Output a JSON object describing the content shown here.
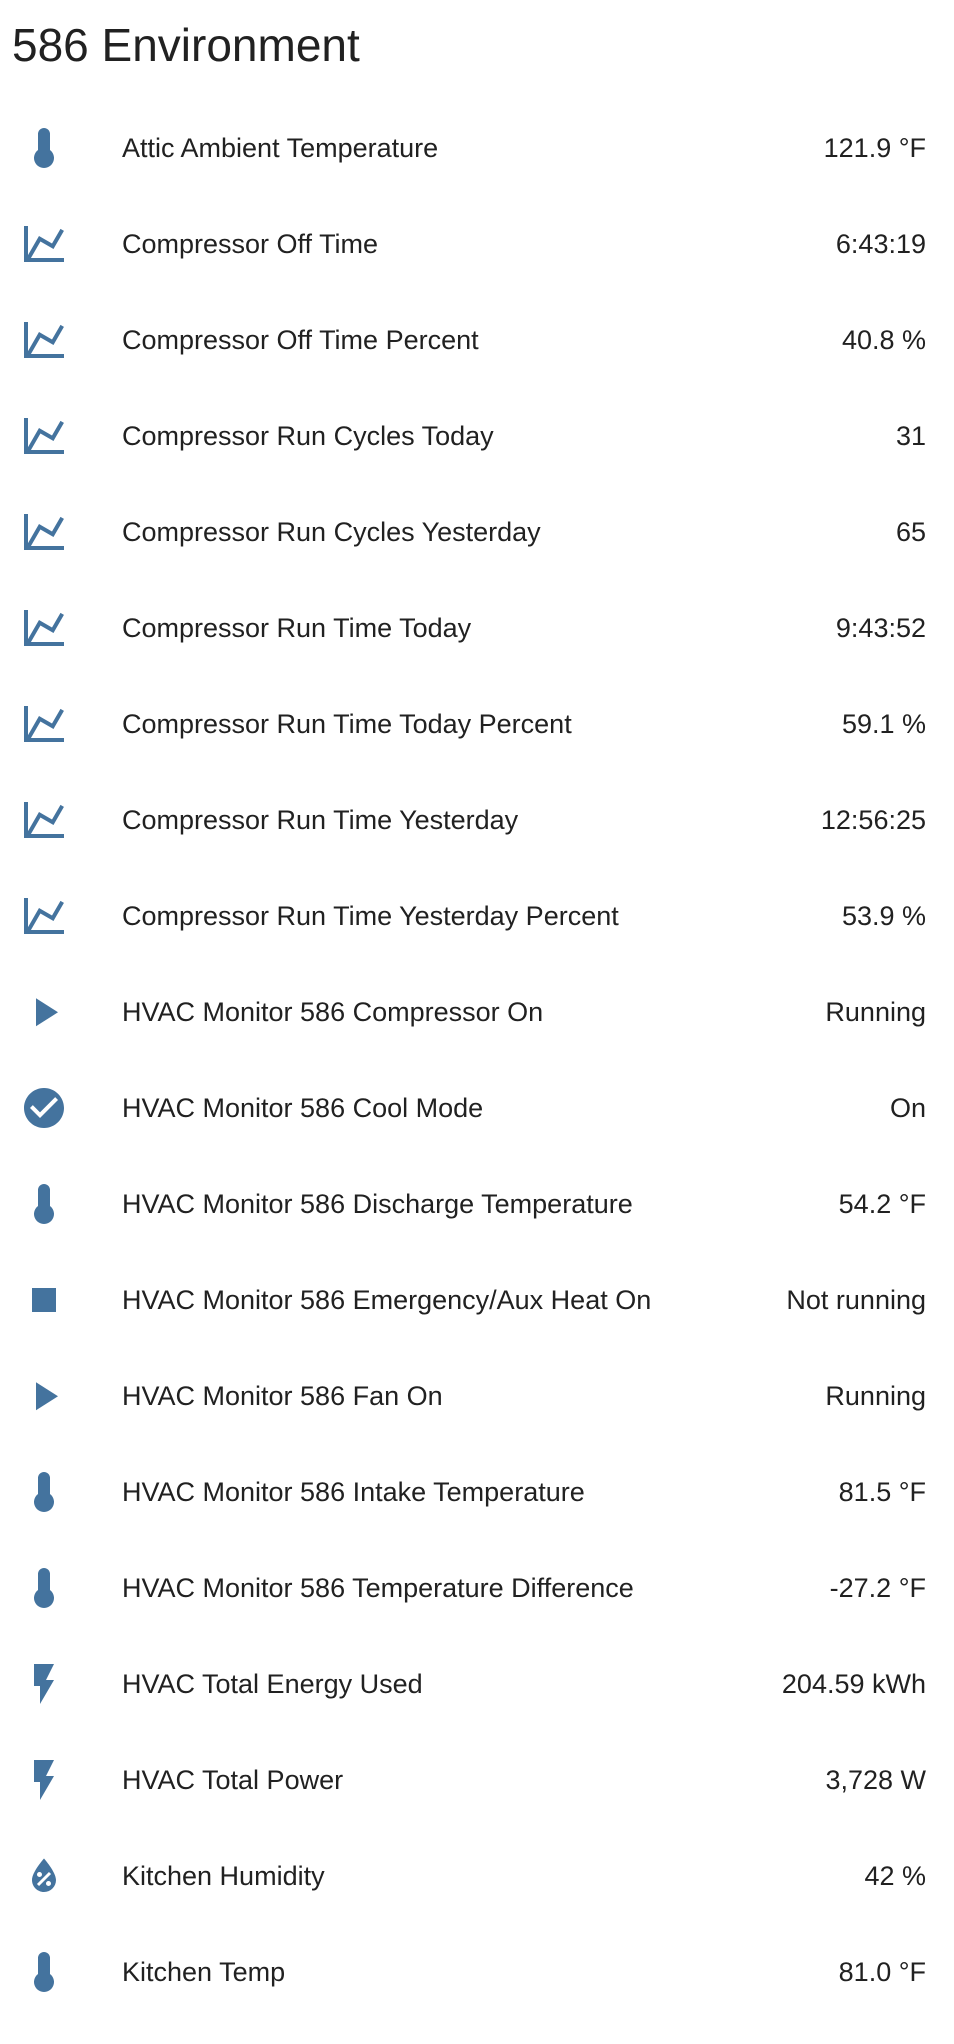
{
  "colors": {
    "icon": "#44739e",
    "text": "#212121",
    "background": "#ffffff"
  },
  "card": {
    "title": "586 Environment"
  },
  "entities": [
    {
      "icon": "thermometer-icon",
      "name": "Attic Ambient Temperature",
      "state": "121.9 °F"
    },
    {
      "icon": "chart-line-icon",
      "name": "Compressor Off Time",
      "state": "6:43:19"
    },
    {
      "icon": "chart-line-icon",
      "name": "Compressor Off Time Percent",
      "state": "40.8 %"
    },
    {
      "icon": "chart-line-icon",
      "name": "Compressor Run Cycles Today",
      "state": "31"
    },
    {
      "icon": "chart-line-icon",
      "name": "Compressor Run Cycles Yesterday",
      "state": "65"
    },
    {
      "icon": "chart-line-icon",
      "name": "Compressor Run Time Today",
      "state": "9:43:52"
    },
    {
      "icon": "chart-line-icon",
      "name": "Compressor Run Time Today Percent",
      "state": "59.1 %"
    },
    {
      "icon": "chart-line-icon",
      "name": "Compressor Run Time Yesterday",
      "state": "12:56:25"
    },
    {
      "icon": "chart-line-icon",
      "name": "Compressor Run Time Yesterday Percent",
      "state": "53.9 %"
    },
    {
      "icon": "play-icon",
      "name": "HVAC Monitor 586 Compressor On",
      "state": "Running"
    },
    {
      "icon": "check-circle-icon",
      "name": "HVAC Monitor 586 Cool Mode",
      "state": "On"
    },
    {
      "icon": "thermometer-icon",
      "name": "HVAC Monitor 586 Discharge Temperature",
      "state": "54.2 °F"
    },
    {
      "icon": "stop-icon",
      "name": "HVAC Monitor 586 Emergency/Aux Heat On",
      "state": "Not running"
    },
    {
      "icon": "play-icon",
      "name": "HVAC Monitor 586 Fan On",
      "state": "Running"
    },
    {
      "icon": "thermometer-icon",
      "name": "HVAC Monitor 586 Intake Temperature",
      "state": "81.5 °F"
    },
    {
      "icon": "thermometer-icon",
      "name": "HVAC Monitor 586 Temperature Difference",
      "state": "-27.2 °F"
    },
    {
      "icon": "flash-icon",
      "name": "HVAC Total Energy Used",
      "state": "204.59 kWh"
    },
    {
      "icon": "flash-icon",
      "name": "HVAC Total Power",
      "state": "3,728 W"
    },
    {
      "icon": "water-percent-icon",
      "name": "Kitchen Humidity",
      "state": "42 %"
    },
    {
      "icon": "thermometer-icon",
      "name": "Kitchen Temp",
      "state": "81.0 °F"
    }
  ]
}
